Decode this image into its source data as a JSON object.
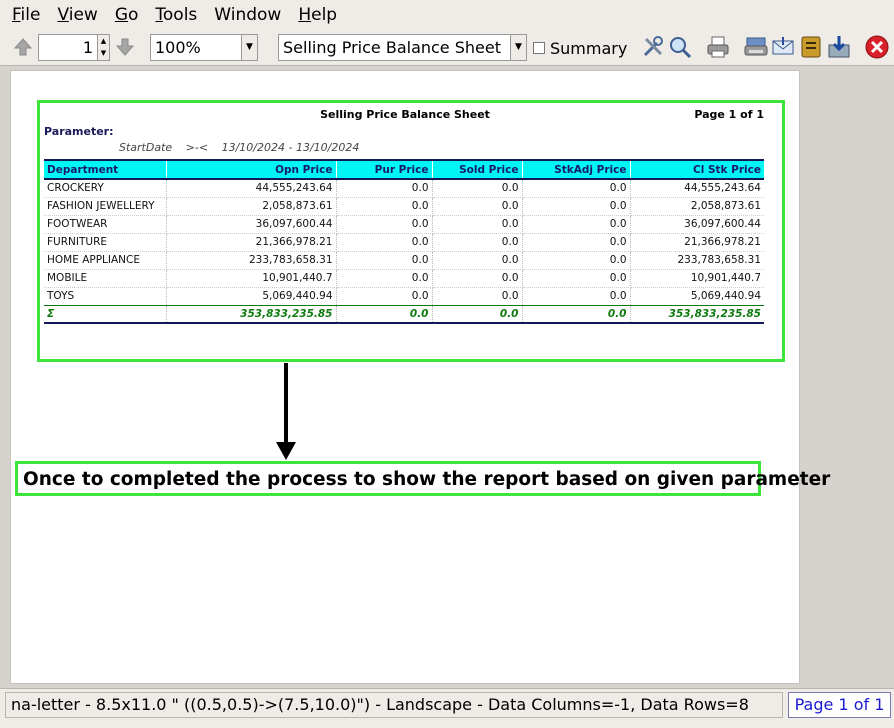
{
  "menu": {
    "items": [
      {
        "key": "F",
        "rest": "ile"
      },
      {
        "key": "V",
        "rest": "iew"
      },
      {
        "key": "G",
        "rest": "o"
      },
      {
        "key": "T",
        "rest": "ools"
      },
      {
        "key": "",
        "rest": "Window"
      },
      {
        "key": "H",
        "rest": "elp"
      }
    ]
  },
  "toolbar": {
    "page_value": "1",
    "zoom_value": "100%",
    "report_select_value": "Selling Price Balance Sheet",
    "summary_label": "Summary",
    "icons": [
      "arrow-up-icon",
      "arrow-down-icon",
      "tools-icon",
      "zoom-icon",
      "print-icon",
      "printer-setup-icon",
      "email-icon",
      "book-icon",
      "export-icon",
      "close-icon"
    ]
  },
  "report": {
    "title": "Selling Price Balance Sheet",
    "page_label": "Page 1 of 1",
    "parameter_label": "Parameter:",
    "param_name": "StartDate",
    "param_op": ">-<",
    "param_value": "13/10/2024 - 13/10/2024",
    "columns": [
      "Department",
      "Opn Price",
      "Pur Price",
      "Sold Price",
      "StkAdj Price",
      "Cl Stk Price"
    ],
    "rows": [
      [
        "CROCKERY",
        "44,555,243.64",
        "0.0",
        "0.0",
        "0.0",
        "44,555,243.64"
      ],
      [
        "FASHION JEWELLERY",
        "2,058,873.61",
        "0.0",
        "0.0",
        "0.0",
        "2,058,873.61"
      ],
      [
        "FOOTWEAR",
        "36,097,600.44",
        "0.0",
        "0.0",
        "0.0",
        "36,097,600.44"
      ],
      [
        "FURNITURE",
        "21,366,978.21",
        "0.0",
        "0.0",
        "0.0",
        "21,366,978.21"
      ],
      [
        "HOME APPLIANCE",
        "233,783,658.31",
        "0.0",
        "0.0",
        "0.0",
        "233,783,658.31"
      ],
      [
        "MOBILE",
        "10,901,440.7",
        "0.0",
        "0.0",
        "0.0",
        "10,901,440.7"
      ],
      [
        "TOYS",
        "5,069,440.94",
        "0.0",
        "0.0",
        "0.0",
        "5,069,440.94"
      ]
    ],
    "total": [
      "Σ",
      "353,833,235.85",
      "0.0",
      "0.0",
      "0.0",
      "353,833,235.85"
    ]
  },
  "annotation": {
    "note": "Once to completed the process to show the report based on given parameter",
    "frame_color": "#3ce43c"
  },
  "status": {
    "text": "na-letter - 8.5x11.0 \" ((0.5,0.5)->(7.5,10.0)\") - Landscape - Data Columns=-1, Data Rows=8",
    "page": "Page 1 of 1"
  }
}
